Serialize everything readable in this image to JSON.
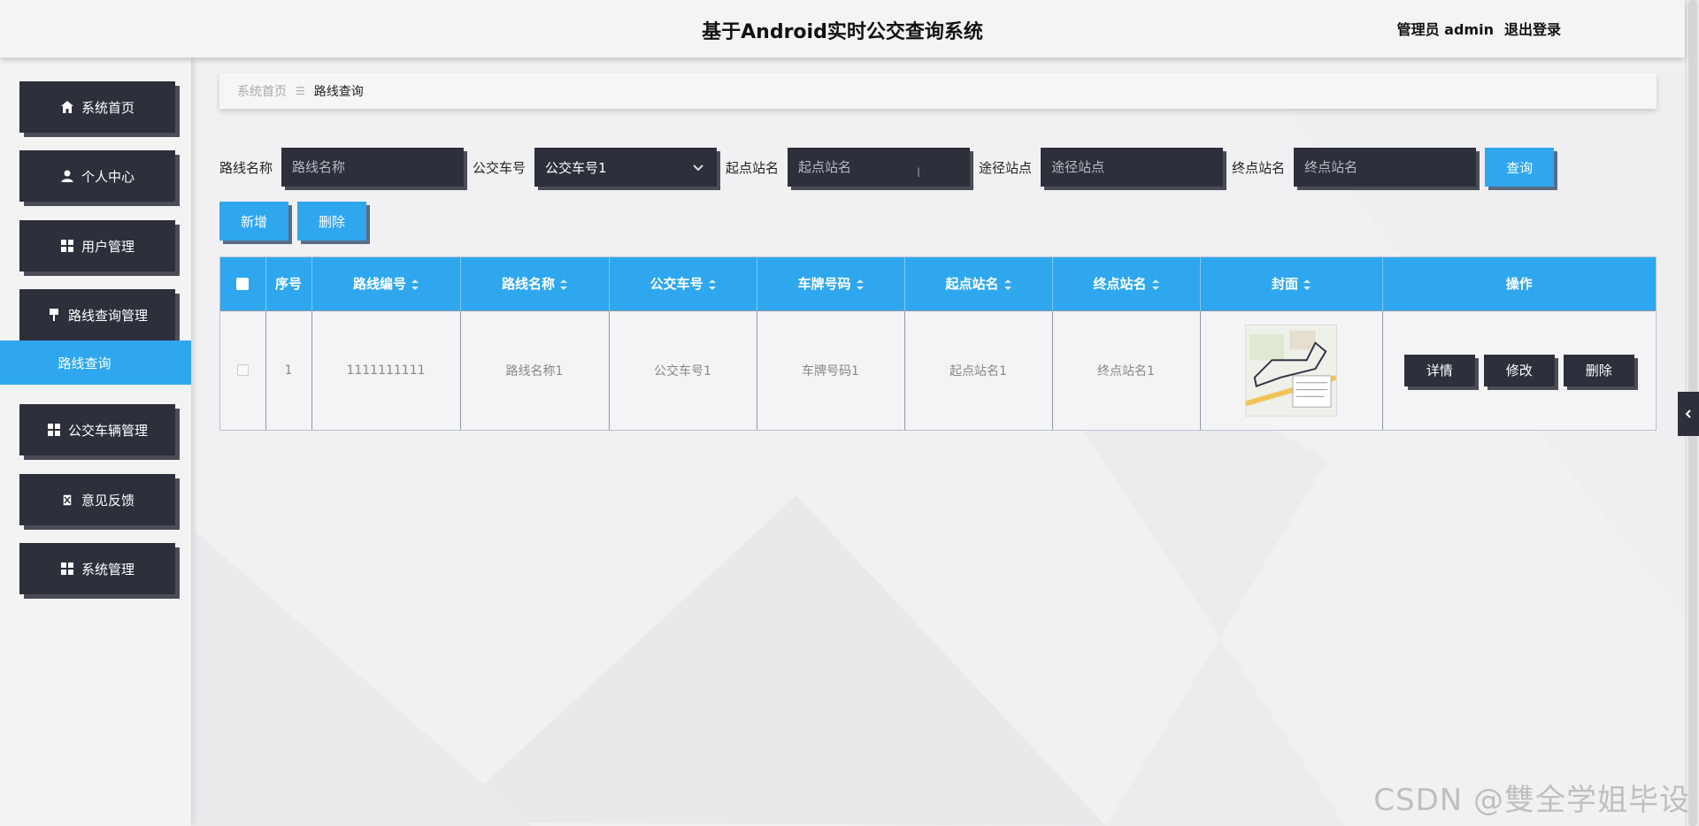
{
  "header": {
    "title": "基于Android实时公交查询系统",
    "user_label": "管理员 admin",
    "logout_label": "退出登录"
  },
  "sidebar": {
    "items": [
      {
        "label": "系统首页",
        "icon": "home-icon"
      },
      {
        "label": "个人中心",
        "icon": "user-icon"
      },
      {
        "label": "用户管理",
        "icon": "grid-icon"
      },
      {
        "label": "路线查询管理",
        "icon": "pin-icon"
      },
      {
        "label": "公交车辆管理",
        "icon": "grid-icon"
      },
      {
        "label": "意见反馈",
        "icon": "clipboard-icon"
      },
      {
        "label": "系统管理",
        "icon": "grid-icon"
      }
    ],
    "active_sub": "路线查询"
  },
  "breadcrumb": {
    "home": "系统首页",
    "separator": "☰",
    "current": "路线查询"
  },
  "search": {
    "route_name_label": "路线名称",
    "route_name_placeholder": "路线名称",
    "bus_no_label": "公交车号",
    "bus_no_selected": "公交车号1",
    "start_label": "起点站名",
    "start_placeholder": "起点站名",
    "via_label": "途径站点",
    "via_placeholder": "途径站点",
    "end_label": "终点站名",
    "end_placeholder": "终点站名",
    "query_btn": "查询"
  },
  "actions": {
    "add": "新增",
    "delete": "删除"
  },
  "table": {
    "columns": [
      "序号",
      "路线编号",
      "路线名称",
      "公交车号",
      "车牌号码",
      "起点站名",
      "终点站名",
      "封面",
      "操作"
    ],
    "rows": [
      {
        "index": "1",
        "route_code": "1111111111",
        "route_name": "路线名称1",
        "bus_no": "公交车号1",
        "plate": "车牌号码1",
        "start": "起点站名1",
        "end": "终点站名1"
      }
    ],
    "row_actions": {
      "detail": "详情",
      "edit": "修改",
      "delete": "删除"
    }
  },
  "watermark": "CSDN @雙全学姐毕设",
  "colors": {
    "accent": "#2ea7ef",
    "dark": "#2d2f3b"
  }
}
